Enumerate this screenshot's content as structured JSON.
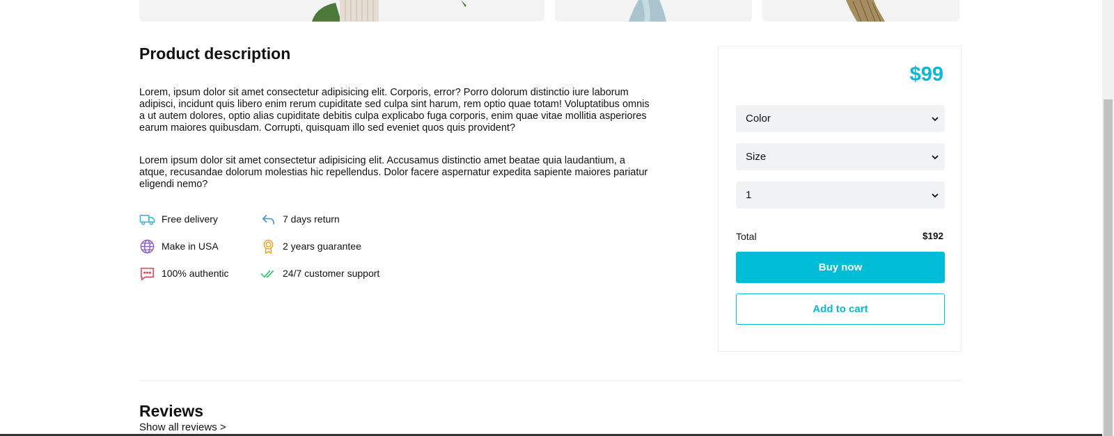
{
  "gallery": {
    "images": [
      "plant-vase-image",
      "blue-vase-image",
      "dried-flowers-image"
    ]
  },
  "description": {
    "title": "Product description",
    "paragraphs": [
      "Lorem, ipsum dolor sit amet consectetur adipisicing elit. Corporis, error? Porro dolorum distinctio iure laborum adipisci, incidunt quis libero enim rerum cupiditate sed culpa sint harum, rem optio quae totam! Voluptatibus omnis a ut autem dolores, optio alias cupiditate debitis culpa explicabo fuga corporis, enim quae vitae mollitia asperiores earum maiores quibusdam. Corrupti, quisquam illo sed eveniet quos quis provident?",
      "Lorem ipsum dolor sit amet consectetur adipisicing elit. Accusamus distinctio amet beatae quia laudantium, a atque, recusandae dolorum molestias hic repellendus. Dolor facere aspernatur expedita sapiente maiores pariatur eligendi nemo?"
    ],
    "features": [
      {
        "label": "Free delivery",
        "icon": "truck-icon",
        "color": "#22b8d6"
      },
      {
        "label": "7 days return",
        "icon": "return-arrow-icon",
        "color": "#3b8fd9"
      },
      {
        "label": "Make in USA",
        "icon": "globe-icon",
        "color": "#8a5cd6"
      },
      {
        "label": "2 years guarantee",
        "icon": "award-icon",
        "color": "#f0a020"
      },
      {
        "label": "100% authentic",
        "icon": "message-icon",
        "color": "#e8334a"
      },
      {
        "label": "24/7 customer support",
        "icon": "double-check-icon",
        "color": "#27c46a"
      }
    ]
  },
  "purchase": {
    "price": "$99",
    "color_select": "Color",
    "size_select": "Size",
    "quantity_select": "1",
    "total_label": "Total",
    "total_value": "$192",
    "buy_label": "Buy now",
    "cart_label": "Add to cart",
    "accent_color": "#00bcd6"
  },
  "reviews": {
    "title": "Reviews",
    "link": "Show all reviews >"
  }
}
